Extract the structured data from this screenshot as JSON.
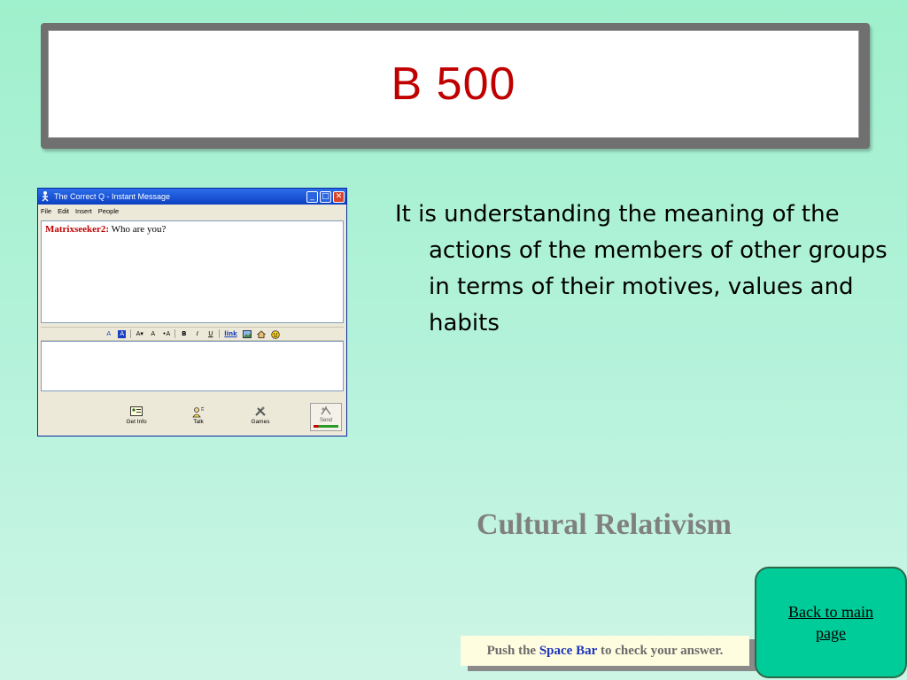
{
  "slide": {
    "title": "B 500",
    "question": "It is understanding the meaning of the actions of the members of other groups in terms of their  motives, values and habits",
    "answer": "Cultural Relativism",
    "back_link": "Back to main page",
    "hint": {
      "prefix": "Push the ",
      "key": "Space Bar",
      "suffix": " to check your answer."
    }
  },
  "im_window": {
    "title": "The Correct Q - Instant Message",
    "window_buttons": {
      "minimize": "_",
      "maximize": "□",
      "close": "✕"
    },
    "menu": [
      "File",
      "Edit",
      "Insert",
      "People"
    ],
    "chat": {
      "name": "Matrixseeker2:",
      "message": " Who are you?"
    },
    "format_toolbar": [
      "A",
      "A",
      "A▾",
      "A",
      "•A",
      "B",
      "I",
      "U",
      "link",
      "img",
      "home",
      "smiley"
    ],
    "actions": [
      {
        "label": "Get Info",
        "icon": "info-card-icon"
      },
      {
        "label": "Talk",
        "icon": "talk-icon"
      },
      {
        "label": "Games",
        "icon": "games-icon"
      }
    ],
    "send_label": "Send"
  }
}
